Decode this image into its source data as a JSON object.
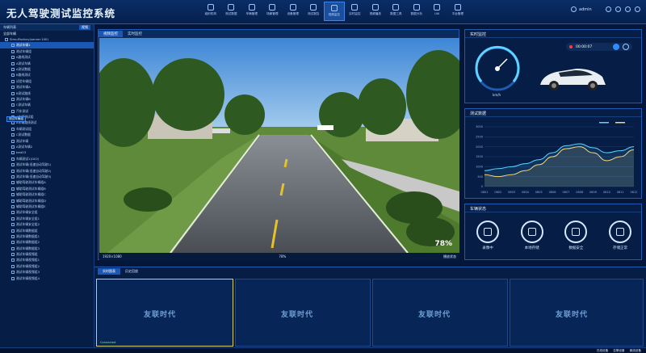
{
  "app": {
    "title": "无人驾驶测试监控系统"
  },
  "nav": [
    {
      "label": "组织机构",
      "icon": "org-icon"
    },
    {
      "label": "测试数据",
      "icon": "data-icon"
    },
    {
      "label": "车辆管理",
      "icon": "car-icon"
    },
    {
      "label": "场景管理",
      "icon": "scene-icon"
    },
    {
      "label": "设备管理",
      "icon": "device-icon"
    },
    {
      "label": "测试报告",
      "icon": "report-icon"
    },
    {
      "label": "视频监控",
      "icon": "monitor-icon"
    },
    {
      "label": "实时监控",
      "icon": "live-icon"
    },
    {
      "label": "视频播放",
      "icon": "play-icon"
    },
    {
      "label": "数据工具",
      "icon": "tool-icon"
    },
    {
      "label": "数据分析",
      "icon": "analysis-icon"
    },
    {
      "label": "UAI",
      "icon": "ai-icon"
    },
    {
      "label": "平台管理",
      "icon": "platform-icon"
    }
  ],
  "user": {
    "name": "admin"
  },
  "sidebar": {
    "tabs": [
      "车辆列表",
      "视频"
    ],
    "header": "全部车辆",
    "tree": [
      "SimulFactory(server:100)",
      "测试车辆1",
      "测试车辆组",
      "A路线测试",
      "A测试车辆",
      "A测试数据",
      "B路线测试",
      "试验车辆组",
      "测试车辆A",
      "B测试路线",
      "测试车辆B",
      "C测试车辆",
      "汽车测试",
      "A车辆测试组",
      "A车辆路线测试",
      "车辆测试组",
      "C测试数据",
      "测试车辆",
      "A测试车辆2",
      "test03",
      "车辆测试1(G02)",
      "测试车辆(低速自动驾驶1)",
      "测试车辆(低速自动驾驶2)",
      "测试车辆(低速自动驾驶3)",
      "辅助驾驶测试车辆组A",
      "辅助驾驶测试车辆组B",
      "辅助驾驶测试车辆组C",
      "辅助驾驶测试车辆组D",
      "辅助驾驶测试车辆组E",
      "测试车辆安全组",
      "测试车辆安全组1",
      "测试车辆安全组2",
      "测试车辆数据组",
      "测试车辆数据组1",
      "测试车辆数据组2",
      "测试车辆数据组3",
      "测试车辆视频组",
      "测试车辆视频组1",
      "测试车辆视频组2",
      "测试车辆视频组3",
      "测试车辆视频组4"
    ],
    "selected": 1,
    "tooltip": "测试车辆组"
  },
  "video": {
    "tabs": [
      "视频监控",
      "实时监控"
    ],
    "overlay_speed": "78%",
    "bar_left": "1920×1080",
    "bar_center": "78%",
    "bar_right": "播放状态"
  },
  "right": {
    "monitor": {
      "title": "实时监控",
      "timer": "00:00:07",
      "gauge_label": "km/h"
    },
    "chart": {
      "title": "测试数据"
    },
    "status": {
      "title": "车辆状态",
      "items": [
        {
          "label": "录像中",
          "icon": "home-icon"
        },
        {
          "label": "本地存储",
          "icon": "gauge-icon"
        },
        {
          "label": "数据安全",
          "icon": "file-icon"
        },
        {
          "label": "存储正常",
          "icon": "hourglass-icon"
        }
      ]
    }
  },
  "bottom": {
    "tabs": [
      "实时图表",
      "历史回放"
    ],
    "watermark": "友联时代",
    "footer": "Connected"
  },
  "statusbar": [
    "在线设备",
    "告警设备",
    "离线设备"
  ],
  "chart_data": {
    "type": "line",
    "x": [
      "0801",
      "0802",
      "0803",
      "0804",
      "0805",
      "0806",
      "0807",
      "0808",
      "0809",
      "0810",
      "0811",
      "0812"
    ],
    "series": [
      {
        "values": [
          800,
          900,
          1000,
          1150,
          1350,
          1700,
          2050,
          2150,
          1950,
          1700,
          1800,
          2000
        ],
        "color": "#5fd3ff"
      },
      {
        "values": [
          600,
          500,
          600,
          800,
          1100,
          1500,
          1900,
          2000,
          1700,
          1300,
          1500,
          1850
        ],
        "color": "#f3d97a"
      }
    ],
    "ylim": [
      0,
      3000
    ],
    "yticks": [
      0,
      500,
      1000,
      1500,
      2000,
      2500,
      3000
    ]
  }
}
